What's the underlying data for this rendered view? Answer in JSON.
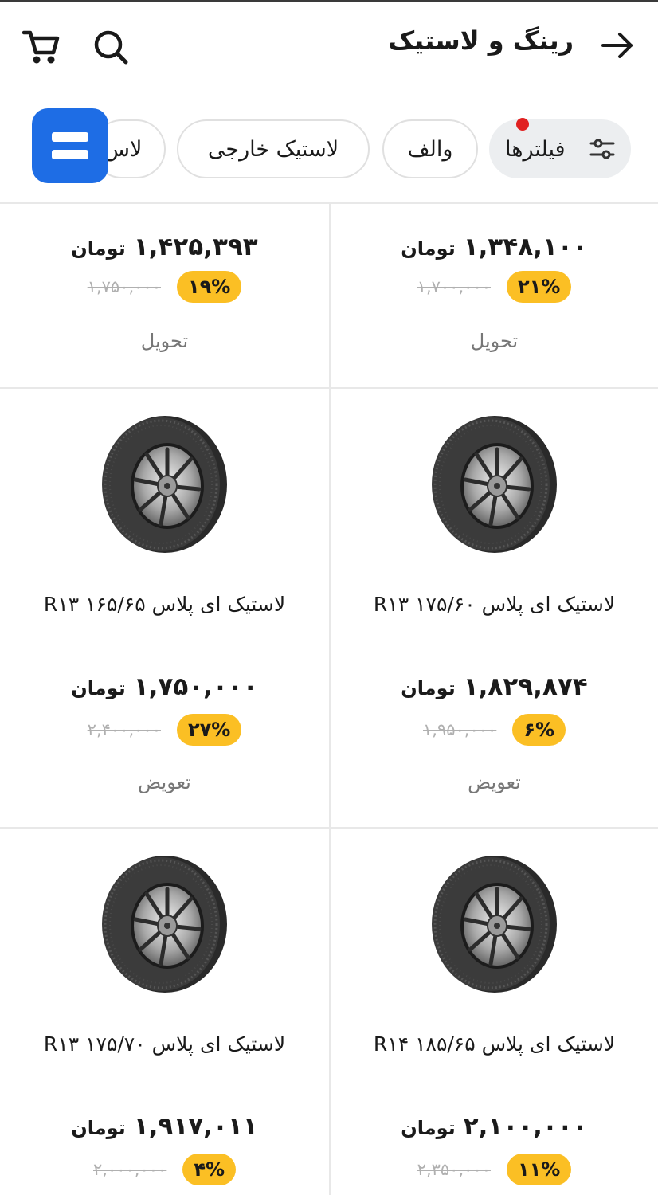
{
  "header": {
    "title": "رینگ و لاستیک",
    "back_icon": "arrow-right-icon",
    "search_icon": "search-icon",
    "cart_icon": "cart-icon"
  },
  "chips": {
    "filter_label": "فیلترها",
    "walf_label": "والف",
    "foreign_label": "لاستیک خارجی",
    "partial_label": "لاس",
    "float_icon": "equals-icon"
  },
  "colors": {
    "accent": "#1e6de5",
    "badge": "#fbbf24",
    "dot": "#e02020"
  },
  "currency": "تومان",
  "products": [
    {
      "name": "",
      "price": "۱,۳۴۸,۱۰۰",
      "old_price": "۱,۷۰۰,۰۰۰",
      "discount": "۲۱%",
      "tag": "تحویل"
    },
    {
      "name": "",
      "price": "۱,۴۲۵,۳۹۳",
      "old_price": "۱,۷۵۰,۰۰۰",
      "discount": "۱۹%",
      "tag": "تحویل"
    },
    {
      "name": "لاستیک ای پلاس ۱۷۵/۶۰ R۱۳",
      "price": "۱,۸۲۹,۸۷۴",
      "old_price": "۱,۹۵۰,۰۰۰",
      "discount": "۶%",
      "tag": "تعویض"
    },
    {
      "name": "لاستیک ای پلاس ۱۶۵/۶۵ R۱۳",
      "price": "۱,۷۵۰,۰۰۰",
      "old_price": "۲,۴۰۰,۰۰۰",
      "discount": "۲۷%",
      "tag": "تعویض"
    },
    {
      "name": "لاستیک ای پلاس ۱۸۵/۶۵ R۱۴",
      "price": "۲,۱۰۰,۰۰۰",
      "old_price": "۲,۳۵۰,۰۰۰",
      "discount": "۱۱%",
      "tag": ""
    },
    {
      "name": "لاستیک ای پلاس ۱۷۵/۷۰ R۱۳",
      "price": "۱,۹۱۷,۰۱۱",
      "old_price": "۲,۰۰۰,۰۰۰",
      "discount": "۴%",
      "tag": ""
    }
  ]
}
